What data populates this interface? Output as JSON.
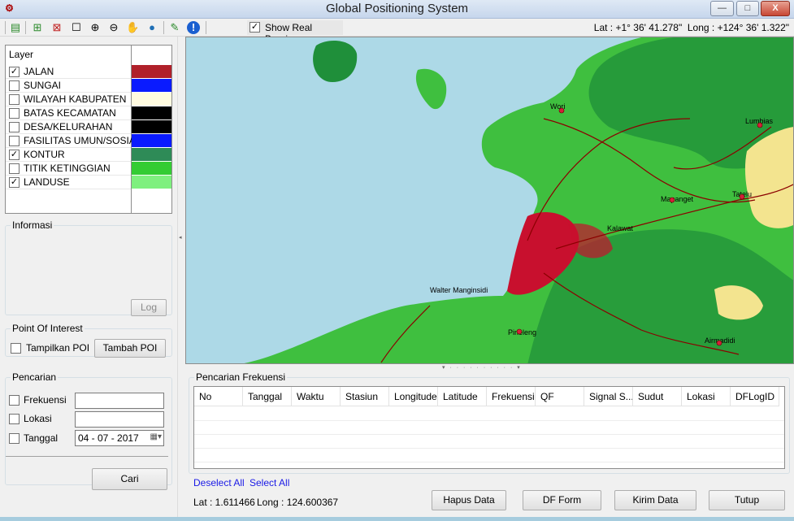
{
  "window": {
    "title": "Global Positioning System",
    "minimize": "—",
    "maximize": "□",
    "close": "X"
  },
  "toolbar": {
    "show_real_bearing": {
      "label": "Show Real Bearing",
      "checked": true
    },
    "lat_readout": "Lat : +1° 36' 41.278\"",
    "long_readout": "Long : +124° 36' 1.322\"",
    "icons": [
      "new-layer-icon",
      "add-data-icon",
      "remove-data-icon",
      "select-box-icon",
      "zoom-in-icon",
      "zoom-out-icon",
      "pan-hand-icon",
      "globe-icon",
      "edit-icon",
      "info-icon"
    ]
  },
  "layers": {
    "header": "Layer",
    "items": [
      {
        "label": "JALAN",
        "checked": true,
        "color": "#b0202a"
      },
      {
        "label": "SUNGAI",
        "checked": false,
        "color": "#0a1bff"
      },
      {
        "label": "WILAYAH KABUPATEN",
        "checked": false,
        "color": "#fffbe0"
      },
      {
        "label": "BATAS KECAMATAN",
        "checked": false,
        "color": "#000000"
      },
      {
        "label": "DESA/KELURAHAN",
        "checked": false,
        "color": "#000000"
      },
      {
        "label": "FASILITAS UMUN/SOSIAL",
        "checked": false,
        "color": "#0a1bff"
      },
      {
        "label": "KONTUR",
        "checked": true,
        "color": "#2e8b57"
      },
      {
        "label": "TITIK KETINGGIAN",
        "checked": false,
        "color": "#33cc33"
      },
      {
        "label": "LANDUSE",
        "checked": true,
        "color": "#7ff07f"
      }
    ]
  },
  "informasi": {
    "title": "Informasi",
    "log_button": "Log"
  },
  "poi": {
    "title": "Point Of Interest",
    "show_label": "Tampilkan POI",
    "add_button": "Tambah POI"
  },
  "pencarian": {
    "title": "Pencarian",
    "frekuensi_label": "Frekuensi",
    "frekuensi_value": "",
    "lokasi_label": "Lokasi",
    "lokasi_value": "",
    "tanggal_label": "Tanggal",
    "tanggal_value": "04 - 07 - 2017",
    "search_button": "Cari"
  },
  "map": {
    "labels": [
      "Walter Manginsidi",
      "Pineleng",
      "Mapanget",
      "Tatelu",
      "Lumbias",
      "Airmadidi",
      "Wori",
      "Kalawat"
    ],
    "colors": {
      "sea": "#add9e7",
      "land": "#3fbf3f",
      "urban": "#c8102e",
      "forest": "#1f8f3a",
      "farmland": "#f3e48f",
      "roads": "#8b0000"
    }
  },
  "frekuensi": {
    "title": "Pencarian Frekuensi",
    "columns": [
      "No",
      "Tanggal",
      "Waktu",
      "Stasiun",
      "Longitude",
      "Latitude",
      "Frekuensi",
      "QF",
      "Signal S...",
      "Sudut",
      "Lokasi",
      "DFLogID"
    ],
    "rows": []
  },
  "links": {
    "deselect_all": "Deselect All",
    "select_all": "Select All"
  },
  "status": {
    "lat": "Lat : 1.611466",
    "long": "Long : 124.600367"
  },
  "buttons": {
    "hapus": "Hapus Data",
    "df_form": "DF Form",
    "kirim": "Kirim Data",
    "tutup": "Tutup"
  }
}
